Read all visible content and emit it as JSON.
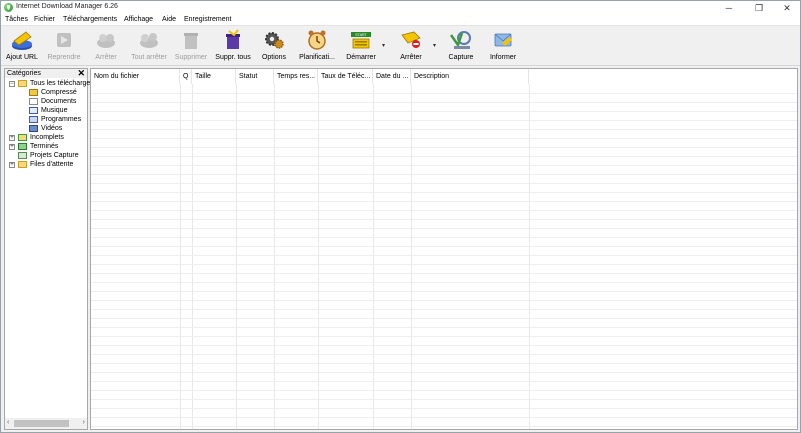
{
  "window": {
    "title": "Internet Download Manager 6.26",
    "controls": {
      "minimize": "─",
      "maximize": "❐",
      "close": "✕"
    }
  },
  "menu": [
    "Tâches",
    "Fichier",
    "Téléchargements",
    "Affichage",
    "Aide",
    "Enregistrement"
  ],
  "toolbar": {
    "add_url": "Ajout URL",
    "resume": "Reprendre",
    "stop": "Arrêter",
    "stop_all": "Tout arrêter",
    "delete": "Supprimer",
    "delete_all": "Suppr. tous",
    "options": "Options",
    "scheduler": "Planificati...",
    "start": "Démarrer",
    "stop_queue": "Arrêter",
    "capture": "Capture",
    "inform": "Informer",
    "dropdown_arrow": "▾",
    "start_badge": "START"
  },
  "categories": {
    "title": "Catégories",
    "close": "✕",
    "items": [
      {
        "label": "Tous les téléchargements",
        "expander": "−",
        "icon": "folder-open-icon"
      },
      {
        "label": "Compressé",
        "icon": "archive-icon"
      },
      {
        "label": "Documents",
        "icon": "document-icon"
      },
      {
        "label": "Musique",
        "icon": "music-icon"
      },
      {
        "label": "Programmes",
        "icon": "program-icon"
      },
      {
        "label": "Vidéos",
        "icon": "video-icon"
      },
      {
        "label": "Incomplets",
        "expander": "+",
        "icon": "incomplete-folder-icon"
      },
      {
        "label": "Terminés",
        "expander": "+",
        "icon": "finished-folder-icon"
      },
      {
        "label": "Projets Capture",
        "icon": "capture-project-icon"
      },
      {
        "label": "Files d'attente",
        "expander": "+",
        "icon": "queue-folder-icon"
      }
    ],
    "scroll_left": "‹",
    "scroll_right": "›"
  },
  "file_list": {
    "columns": [
      "Nom du fichier",
      "Q",
      "Taille",
      "Statut",
      "Temps res...",
      "Taux de Téléc...",
      "Date du ...",
      "Description"
    ],
    "rows": []
  },
  "colors": {
    "accent_yellow": "#f5c400",
    "border": "#a8a8a8"
  }
}
